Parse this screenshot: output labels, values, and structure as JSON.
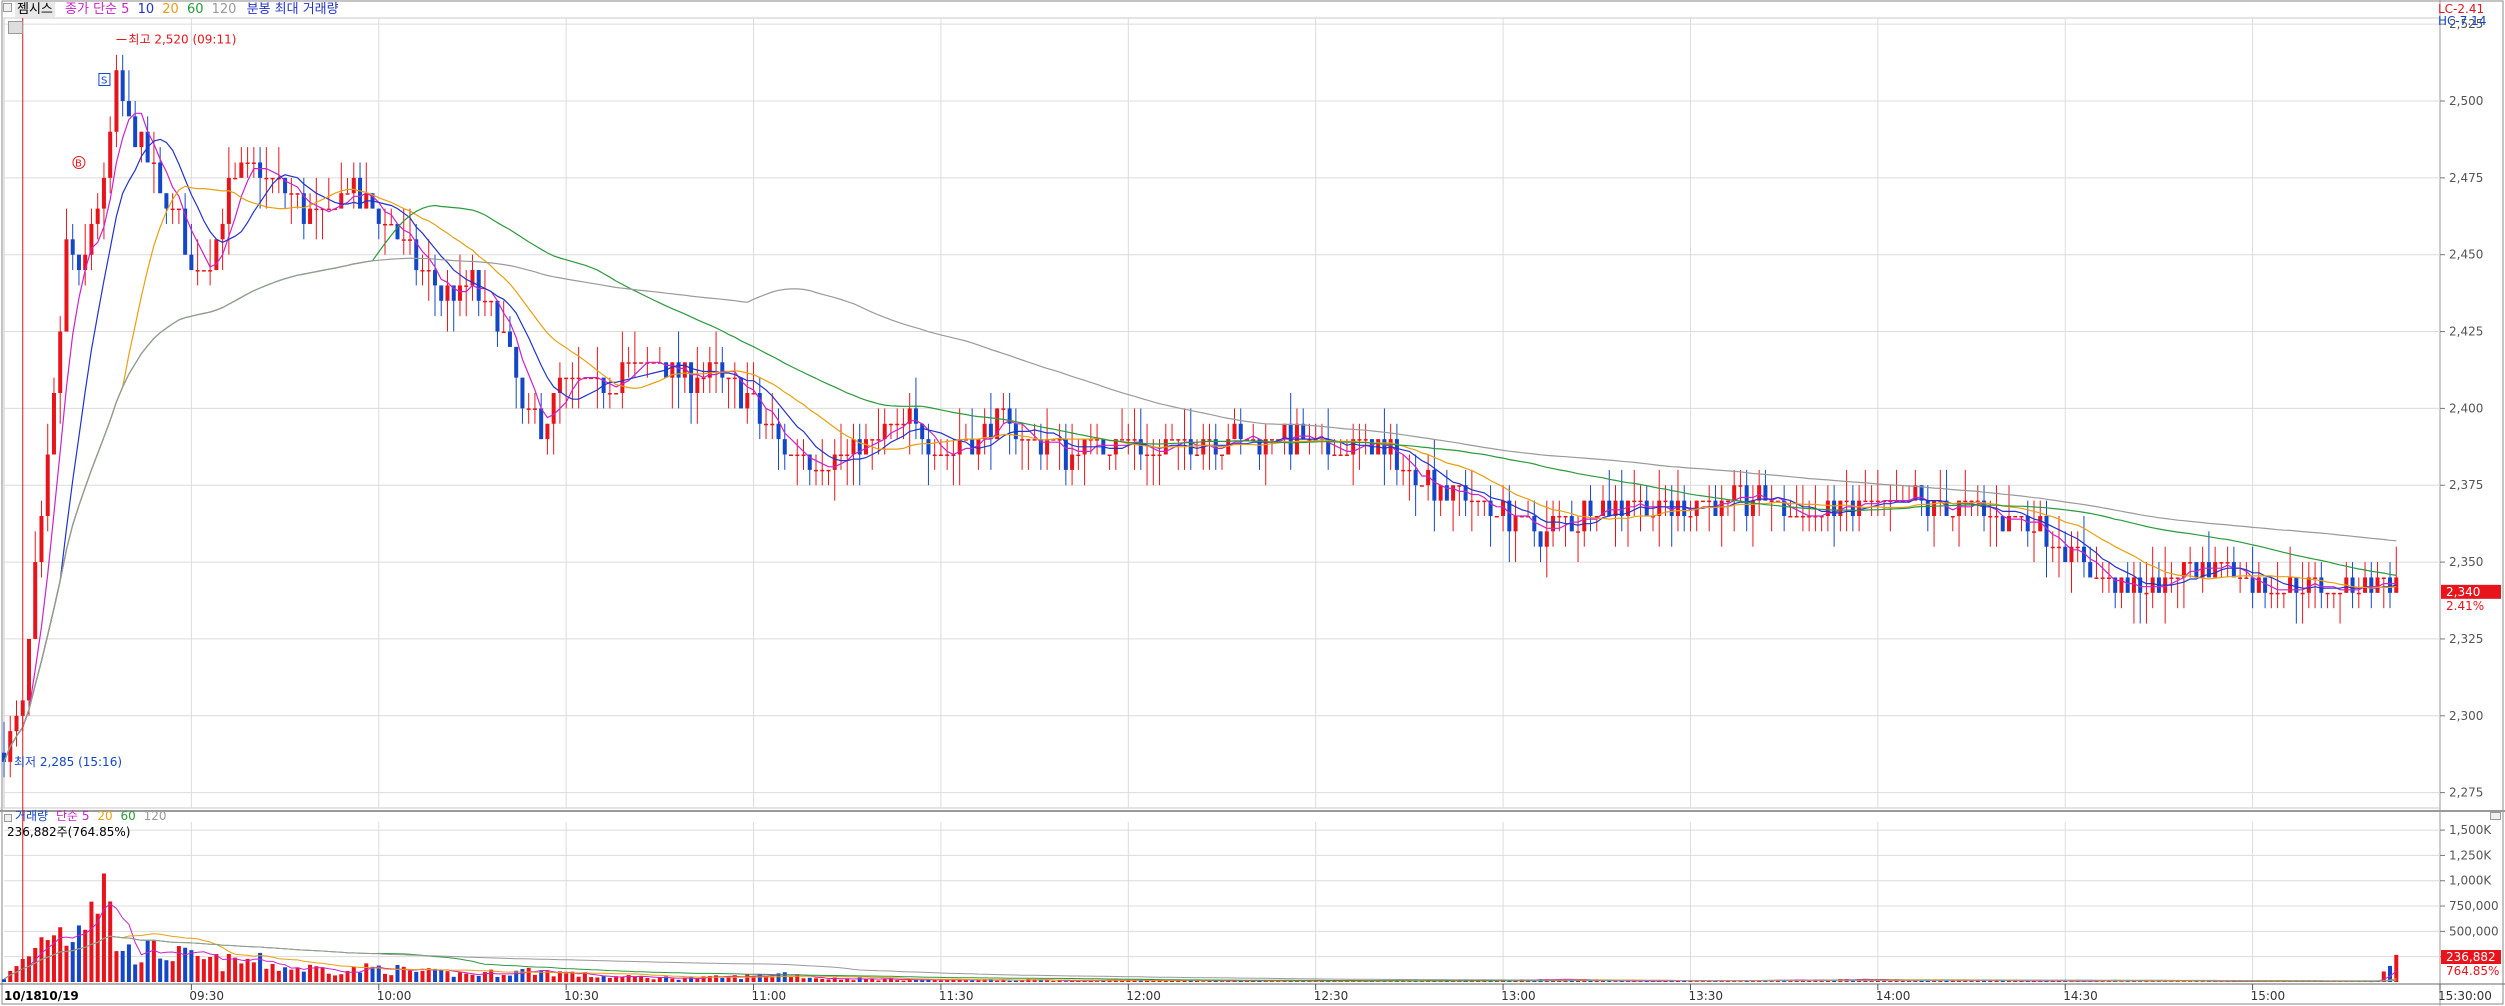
{
  "header": {
    "stock_name": "젬시스",
    "price_indicator": "종가 단순",
    "price_ma_periods": [
      "5",
      "10",
      "20",
      "60",
      "120"
    ],
    "overlay_label": "분봉 최대 거래량",
    "lc_label": "LC-2.41",
    "hc_label": "HC-7.14"
  },
  "volume_header": {
    "title": "거래량",
    "indicator": "단순",
    "ma_periods": [
      "5",
      "20",
      "60",
      "120"
    ],
    "current_text": "236,882주(764.85%)"
  },
  "colors": {
    "up": "#e8141c",
    "down": "#1446c8",
    "ma5": "#cc22cc",
    "ma10": "#2233cc",
    "ma20": "#e8a010",
    "ma60": "#2a9a3a",
    "ma120": "#9a9a9a",
    "grid": "#dcdcdc",
    "axis_label": "#555555"
  },
  "chart_data": {
    "type": "candlestick",
    "date_label": "10/18",
    "date_label2": "10/19",
    "x_ticks": [
      "09:30",
      "10:00",
      "10:30",
      "11:00",
      "11:30",
      "12:00",
      "12:30",
      "13:00",
      "13:30",
      "14:00",
      "14:30",
      "15:00",
      "15:30:00"
    ],
    "x_tick_minutes": [
      30,
      60,
      90,
      120,
      150,
      180,
      210,
      240,
      270,
      300,
      330,
      360,
      390
    ],
    "price_axis": {
      "min": 2270,
      "max": 2527,
      "ticks": [
        "2,525",
        "2,500",
        "2,475",
        "2,450",
        "2,425",
        "2,400",
        "2,375",
        "2,350",
        "2,325",
        "2,300",
        "2,275"
      ]
    },
    "volume_axis": {
      "min": 0,
      "max": 1580000,
      "ticks": [
        "1,500K",
        "1,250K",
        "1,000K",
        "750,000",
        "500,000",
        "250,000"
      ]
    },
    "annotations": {
      "high": "최고 2,520 (09:11)",
      "low": "최저 2,285 (15:16)",
      "current_price": "2,340",
      "current_pct": "2.41%",
      "current_volume": "236,882",
      "volume_pct": "764.85%",
      "buy_marker": "B",
      "sell_marker": "S"
    },
    "price_points": [
      [
        0,
        2288
      ],
      [
        3,
        2300
      ],
      [
        5,
        2345
      ],
      [
        8,
        2400
      ],
      [
        10,
        2455
      ],
      [
        12,
        2440
      ],
      [
        14,
        2460
      ],
      [
        16,
        2470
      ],
      [
        18,
        2505
      ],
      [
        20,
        2495
      ],
      [
        22,
        2485
      ],
      [
        25,
        2470
      ],
      [
        28,
        2460
      ],
      [
        30,
        2445
      ],
      [
        33,
        2450
      ],
      [
        36,
        2470
      ],
      [
        40,
        2480
      ],
      [
        45,
        2470
      ],
      [
        50,
        2460
      ],
      [
        55,
        2470
      ],
      [
        60,
        2465
      ],
      [
        65,
        2450
      ],
      [
        70,
        2435
      ],
      [
        75,
        2440
      ],
      [
        80,
        2425
      ],
      [
        83,
        2400
      ],
      [
        86,
        2395
      ],
      [
        90,
        2410
      ],
      [
        95,
        2405
      ],
      [
        100,
        2415
      ],
      [
        105,
        2415
      ],
      [
        110,
        2410
      ],
      [
        115,
        2410
      ],
      [
        120,
        2400
      ],
      [
        125,
        2385
      ],
      [
        130,
        2385
      ],
      [
        135,
        2385
      ],
      [
        140,
        2390
      ],
      [
        145,
        2395
      ],
      [
        150,
        2385
      ],
      [
        155,
        2390
      ],
      [
        160,
        2395
      ],
      [
        165,
        2390
      ],
      [
        170,
        2385
      ],
      [
        175,
        2390
      ],
      [
        180,
        2390
      ],
      [
        185,
        2385
      ],
      [
        190,
        2390
      ],
      [
        195,
        2390
      ],
      [
        200,
        2390
      ],
      [
        205,
        2390
      ],
      [
        210,
        2388
      ],
      [
        215,
        2387
      ],
      [
        220,
        2387
      ],
      [
        225,
        2380
      ],
      [
        230,
        2375
      ],
      [
        235,
        2370
      ],
      [
        240,
        2365
      ],
      [
        245,
        2360
      ],
      [
        250,
        2362
      ],
      [
        255,
        2368
      ],
      [
        260,
        2370
      ],
      [
        265,
        2368
      ],
      [
        270,
        2368
      ],
      [
        275,
        2368
      ],
      [
        280,
        2370
      ],
      [
        285,
        2368
      ],
      [
        290,
        2365
      ],
      [
        295,
        2368
      ],
      [
        300,
        2368
      ],
      [
        305,
        2370
      ],
      [
        310,
        2368
      ],
      [
        315,
        2368
      ],
      [
        320,
        2365
      ],
      [
        325,
        2362
      ],
      [
        330,
        2355
      ],
      [
        335,
        2345
      ],
      [
        340,
        2340
      ],
      [
        345,
        2342
      ],
      [
        350,
        2348
      ],
      [
        355,
        2350
      ],
      [
        360,
        2345
      ],
      [
        365,
        2342
      ],
      [
        370,
        2340
      ],
      [
        375,
        2340
      ],
      [
        380,
        2345
      ],
      [
        383,
        2343
      ]
    ],
    "volume_points": [
      [
        0,
        40000
      ],
      [
        3,
        200000
      ],
      [
        5,
        350000
      ],
      [
        8,
        600000
      ],
      [
        10,
        480000
      ],
      [
        14,
        900000
      ],
      [
        16,
        1000000
      ],
      [
        18,
        420000
      ],
      [
        20,
        300000
      ],
      [
        25,
        320000
      ],
      [
        30,
        240000
      ],
      [
        35,
        200000
      ],
      [
        40,
        220000
      ],
      [
        45,
        150000
      ],
      [
        50,
        140000
      ],
      [
        55,
        120000
      ],
      [
        60,
        150000
      ],
      [
        65,
        110000
      ],
      [
        70,
        90000
      ],
      [
        75,
        80000
      ],
      [
        80,
        100000
      ],
      [
        85,
        120000
      ],
      [
        90,
        90000
      ],
      [
        95,
        60000
      ],
      [
        100,
        50000
      ],
      [
        110,
        40000
      ],
      [
        120,
        60000
      ],
      [
        125,
        90000
      ],
      [
        130,
        40000
      ],
      [
        140,
        30000
      ],
      [
        150,
        20000
      ],
      [
        160,
        25000
      ],
      [
        170,
        15000
      ],
      [
        180,
        18000
      ],
      [
        200,
        12000
      ],
      [
        220,
        10000
      ],
      [
        240,
        20000
      ],
      [
        250,
        22000
      ],
      [
        260,
        10000
      ],
      [
        280,
        15000
      ],
      [
        300,
        25000
      ],
      [
        320,
        12000
      ],
      [
        340,
        10000
      ],
      [
        360,
        8000
      ],
      [
        380,
        8000
      ],
      [
        383,
        236882
      ]
    ]
  }
}
